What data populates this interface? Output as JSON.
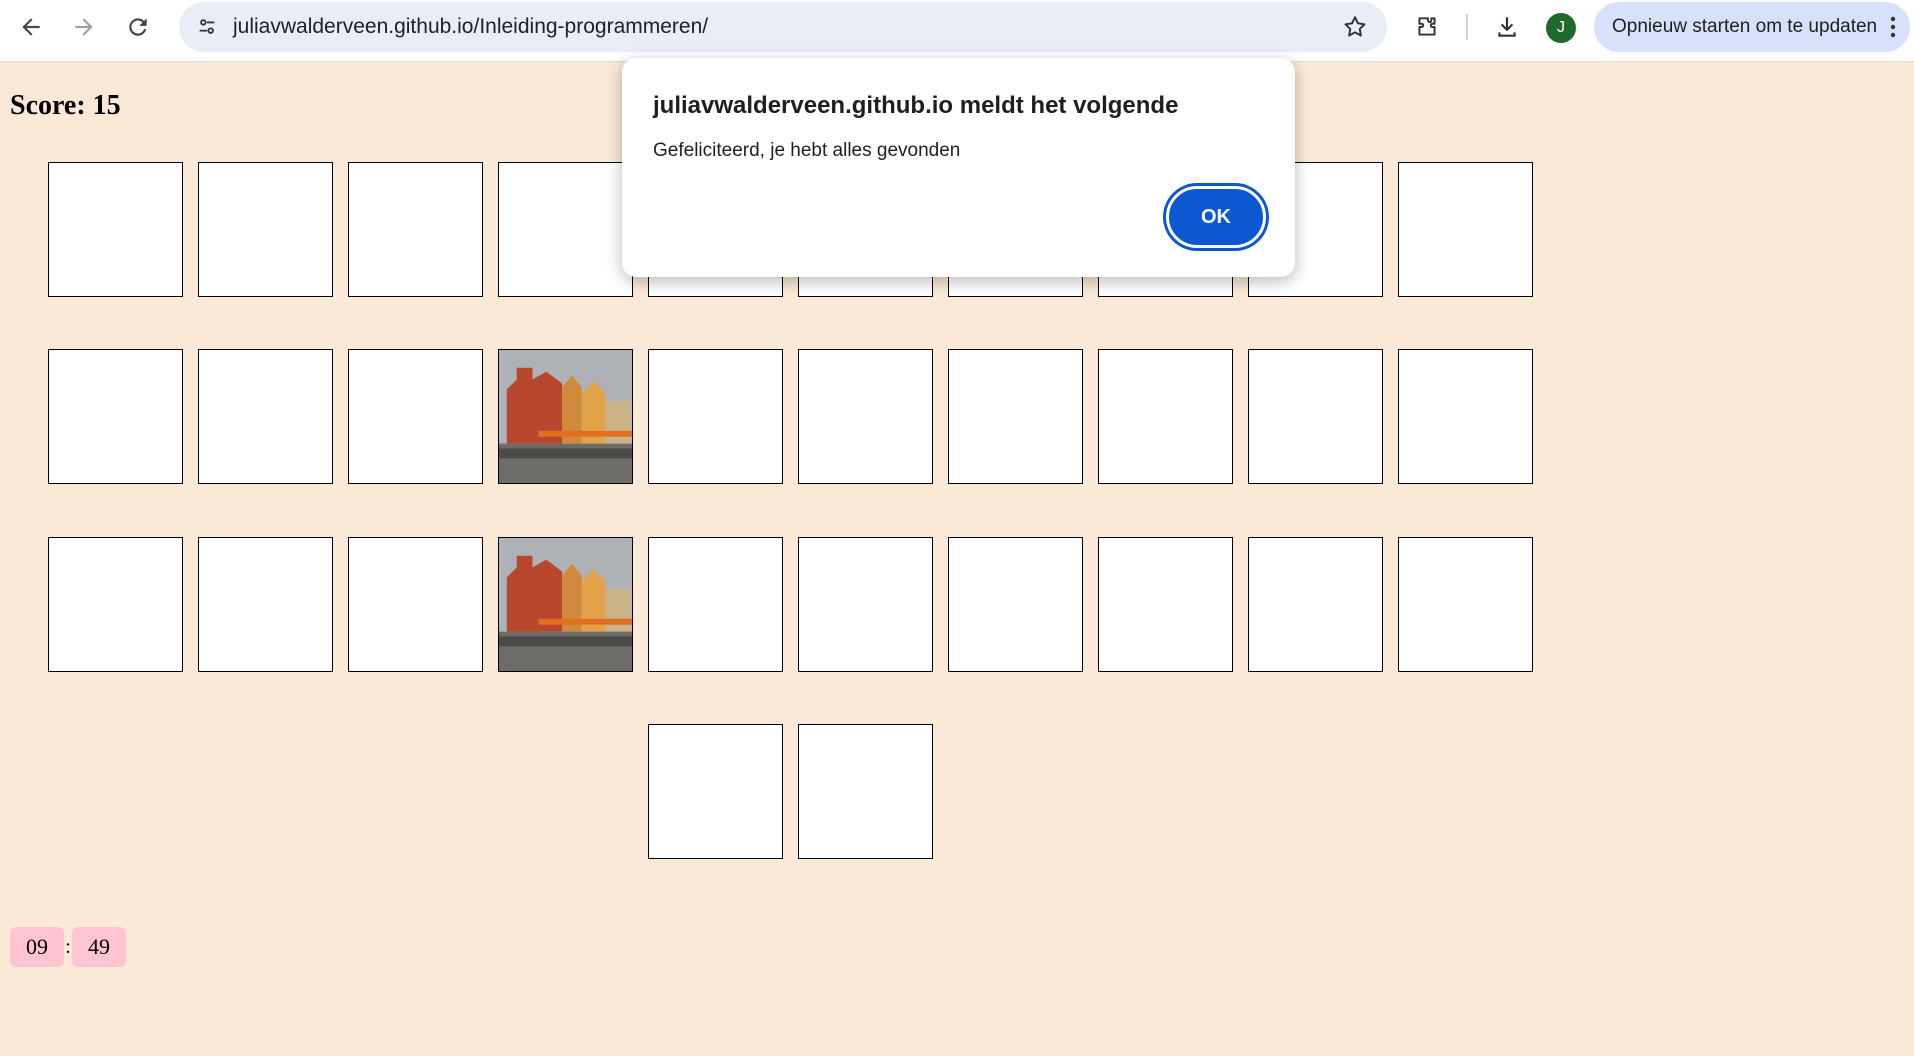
{
  "browser": {
    "url": "juliavwalderveen.github.io/Inleiding-programmeren/",
    "profile_initial": "J",
    "update_button_label": "Opnieuw starten om te updaten"
  },
  "page": {
    "score_text": "Score: 15",
    "timer": {
      "minutes": "09",
      "separator": ":",
      "seconds": "49"
    },
    "card_rows": [
      {
        "cards": [
          "blank",
          "blank",
          "blank",
          "blank",
          "blank",
          "blank",
          "blank",
          "blank",
          "blank",
          "blank"
        ]
      },
      {
        "cards": [
          "blank",
          "blank",
          "blank",
          "photo",
          "blank",
          "blank",
          "blank",
          "blank",
          "blank",
          "blank"
        ]
      },
      {
        "cards": [
          "blank",
          "blank",
          "blank",
          "photo",
          "blank",
          "blank",
          "blank",
          "blank",
          "blank",
          "blank"
        ]
      },
      {
        "cards": [
          "blank",
          "blank"
        ]
      }
    ]
  },
  "dialog": {
    "title": "juliavwalderveen.github.io meldt het volgende",
    "message": "Gefeliciteerd, je hebt alles gevonden",
    "ok_label": "OK"
  },
  "colors": {
    "page_background": "#f9e9d6",
    "timer_background": "#ffc4d1",
    "dialog_button": "#0b57d0",
    "avatar": "#1e6a2a"
  },
  "icons": [
    "back-arrow-icon",
    "forward-arrow-icon",
    "reload-icon",
    "site-settings-icon",
    "bookmark-star-icon",
    "extensions-icon",
    "download-icon",
    "more-vert-icon"
  ]
}
